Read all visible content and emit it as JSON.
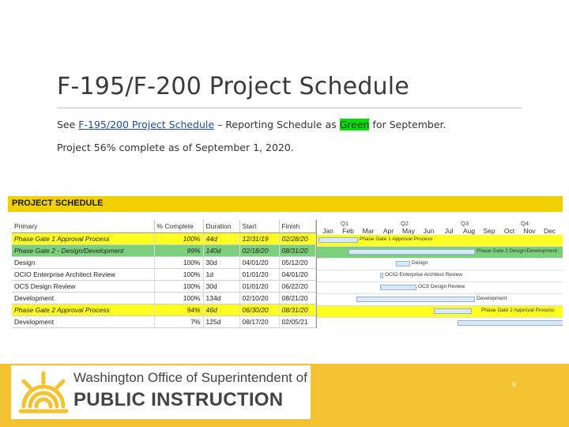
{
  "slide": {
    "title": "F-195/F-200 Project Schedule",
    "line1_prefix": "See ",
    "line1_link": "F-195/200 Project Schedule",
    "line1_mid": " – Reporting Schedule as ",
    "line1_status": "Green",
    "line1_suffix": " for September.",
    "line2": "Project 56% complete as of September 1, 2020.",
    "page_number": "9"
  },
  "schedule": {
    "header": "PROJECT SCHEDULE",
    "columns": [
      "Primary",
      "% Complete",
      "Duration",
      "Start",
      "Finish"
    ],
    "quarters": [
      "Q1",
      "Q2",
      "Q3",
      "Q4"
    ],
    "months": [
      "Jan",
      "Feb",
      "Mar",
      "Apr",
      "May",
      "Jun",
      "Jul",
      "Aug",
      "Sep",
      "Oct",
      "Nov",
      "Dec"
    ],
    "rows": [
      {
        "task": "Phase Gate 1 Approval Process",
        "pct": "100%",
        "dur": "44d",
        "start": "12/31/19",
        "finish": "02/28/20",
        "style": "yel",
        "bar_label": "Phase Gate 1 Approval Process"
      },
      {
        "task": "Phase Gate 2 - Design/Development",
        "pct": "99%",
        "dur": "140d",
        "start": "02/18/20",
        "finish": "08/31/20",
        "style": "grn",
        "bar_label": "Phase Gate 2  Design/Development"
      },
      {
        "task": "Design",
        "pct": "100%",
        "dur": "30d",
        "start": "04/01/20",
        "finish": "05/12/20",
        "style": "",
        "bar_label": "Design"
      },
      {
        "task": "OCIO Enterprise Architect Review",
        "pct": "100%",
        "dur": "1d",
        "start": "01/01/20",
        "finish": "04/01/20",
        "style": "",
        "bar_label": "OCIO Enterprise Architect Review"
      },
      {
        "task": "OCS Design Review",
        "pct": "100%",
        "dur": "30d",
        "start": "01/01/20",
        "finish": "06/22/20",
        "style": "",
        "bar_label": "OCS Design Review"
      },
      {
        "task": "Development",
        "pct": "100%",
        "dur": "134d",
        "start": "02/10/20",
        "finish": "08/21/20",
        "style": "",
        "bar_label": "Development"
      },
      {
        "task": "Phase Gate 2 Approval Process",
        "pct": "94%",
        "dur": "46d",
        "start": "06/30/20",
        "finish": "08/31/20",
        "style": "yel",
        "bar_label": "Phase Gate 2 Approval Process"
      },
      {
        "task": "Development",
        "pct": "7%",
        "dur": "125d",
        "start": "08/17/20",
        "finish": "02/05/21",
        "style": "",
        "bar_label": ""
      }
    ]
  },
  "footer": {
    "org_line1": "Washington Office of Superintendent of",
    "org_line2": "PUBLIC INSTRUCTION"
  },
  "colors": {
    "header_yellow": "#f0d000",
    "row_yellow": "#ffff20",
    "row_green": "#7ccf7c",
    "footer_gold": "#f2c230",
    "status_green": "#00e000"
  }
}
